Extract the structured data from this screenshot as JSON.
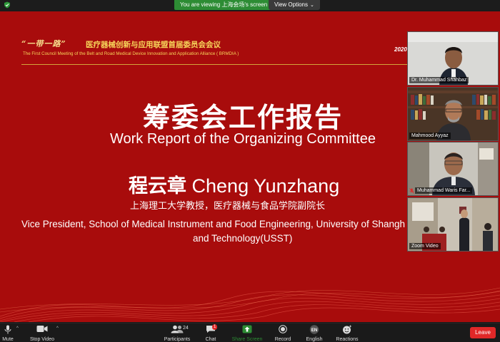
{
  "topbar": {
    "viewing_text": "You are viewing 上海会场's screen",
    "view_options": "View Options"
  },
  "slide": {
    "logo_text": "“一带一路”",
    "conference_title_cn": "医疗器械创新与应用联盟首届委员会会议",
    "conference_title_en": "The First Council Meeting of the Belt and Road Medical Device Innovation and Application Alliance ( BRMDIA )",
    "date": "2020-",
    "title_cn": "筹委会工作报告",
    "title_en": "Work Report of the Organizing Committee",
    "speaker_cn": "程云章",
    "speaker_en": "Cheng Yunzhang",
    "affiliation_cn": "上海理工大学教授，医疗器械与食品学院副院长",
    "affiliation_en_line1": "Vice President, School of Medical Instrument and Food Engineering, University of Shangh",
    "affiliation_en_line2": "and Technology(USST)"
  },
  "participants": [
    {
      "name": "Dr. Muhammad Shahbaz"
    },
    {
      "name": "Mahmood Ayyaz"
    },
    {
      "name": "Muhammad Waris Far..."
    },
    {
      "name": "Zoom Video"
    }
  ],
  "toolbar": {
    "mute": "Mute",
    "stop_video": "Stop Video",
    "participants": "Participants",
    "participants_count": "24",
    "chat": "Chat",
    "chat_badge": "1",
    "share_screen": "Share Screen",
    "record": "Record",
    "english": "English",
    "english_icon_text": "EN",
    "reactions": "Reactions",
    "leave": "Leave"
  },
  "colors": {
    "slide_bg": "#a80c0c",
    "share_green": "#2d8c34",
    "leave_red": "#e02828",
    "gold": "#f7d65a"
  }
}
